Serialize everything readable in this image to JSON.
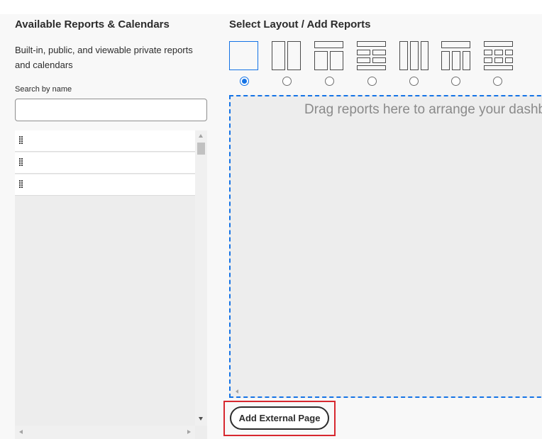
{
  "left_panel": {
    "title": "Available Reports & Calendars",
    "description": "Built-in, public, and viewable private reports and calendars",
    "search": {
      "label": "Search by name",
      "value": "",
      "placeholder": ""
    },
    "items": [
      {
        "label": "",
        "icon": "drag-handle-icon"
      },
      {
        "label": "",
        "icon": "drag-handle-icon"
      },
      {
        "label": "",
        "icon": "drag-handle-icon"
      }
    ]
  },
  "right_panel": {
    "title": "Select Layout / Add Reports",
    "layouts": [
      {
        "name": "single-column",
        "selected": true
      },
      {
        "name": "two-columns",
        "selected": false
      },
      {
        "name": "header-two-columns",
        "selected": false
      },
      {
        "name": "header-two-by-two-footer",
        "selected": false
      },
      {
        "name": "three-columns",
        "selected": false
      },
      {
        "name": "header-three-columns",
        "selected": false
      },
      {
        "name": "header-three-by-two-footer",
        "selected": false
      }
    ],
    "drop_zone_text": "Drag reports here to arrange your dashbo",
    "add_external_page_label": "Add External Page"
  },
  "colors": {
    "accent": "#1473e6",
    "highlight": "#d7282f",
    "panel_bg": "#ededed",
    "page_bg": "#f8f8f8"
  }
}
